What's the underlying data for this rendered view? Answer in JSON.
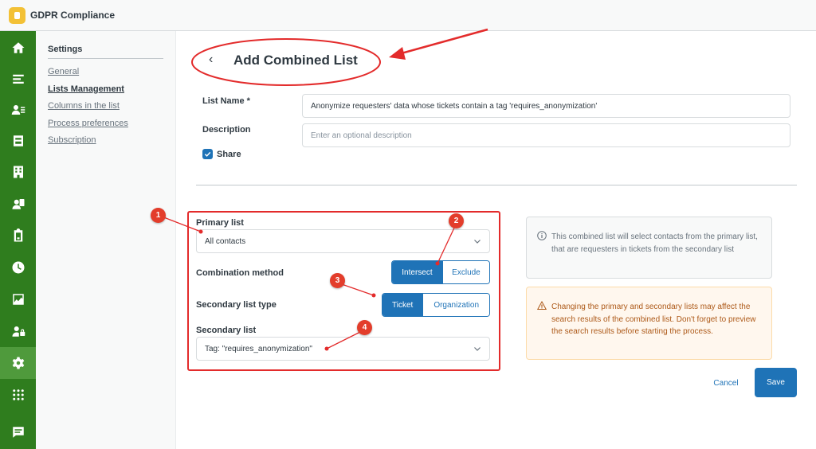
{
  "app": {
    "title": "GDPR Compliance",
    "logo_icon": "lock-shield-icon",
    "accent": "#1f73b7",
    "rail_color": "#2f7d1e",
    "annotation_color": "#e32b2b"
  },
  "rail": {
    "items": [
      {
        "icon": "home-icon"
      },
      {
        "icon": "views-icon"
      },
      {
        "icon": "customers-icon"
      },
      {
        "icon": "reporting-icon"
      },
      {
        "icon": "organizations-icon"
      },
      {
        "icon": "contacts-icon"
      },
      {
        "icon": "clipboard-icon"
      },
      {
        "icon": "clock-icon"
      },
      {
        "icon": "chart-icon"
      },
      {
        "icon": "user-lock-icon"
      },
      {
        "icon": "gear-icon",
        "active": true
      },
      {
        "icon": "apps-grid-icon"
      },
      {
        "icon": "chat-icon"
      }
    ]
  },
  "sidenav": {
    "heading": "Settings",
    "links": [
      "General",
      "Lists Management",
      "Columns in the list",
      "Process preferences",
      "Subscription"
    ],
    "current": "Lists Management"
  },
  "page": {
    "back_glyph": "‹",
    "title": "Add Combined List"
  },
  "form": {
    "list_name_label": "List Name *",
    "list_name_value": "Anonymize requesters' data whose tickets contain a tag 'requires_anonymization'",
    "description_label": "Description",
    "description_placeholder": "Enter an optional description",
    "share_label": "Share",
    "share_checked": true
  },
  "combine": {
    "primary_label": "Primary list",
    "primary_value": "All contacts",
    "method_label": "Combination method",
    "method_options": [
      "Intersect",
      "Exclude"
    ],
    "method_selected": "Intersect",
    "secondary_type_label": "Secondary list type",
    "secondary_type_options": [
      "Ticket",
      "Organization"
    ],
    "secondary_type_selected": "Ticket",
    "secondary_label": "Secondary list",
    "secondary_value": "Tag: \"requires_anonymization\""
  },
  "info_note": "This combined list will select contacts from the primary list, that are requesters in tickets from the secondary list",
  "warning_note": "Changing the primary and secondary lists may affect the search results of the combined list. Don't forget to preview the search results before starting the process.",
  "actions": {
    "cancel": "Cancel",
    "save": "Save"
  },
  "callouts": [
    "1",
    "2",
    "3",
    "4"
  ]
}
